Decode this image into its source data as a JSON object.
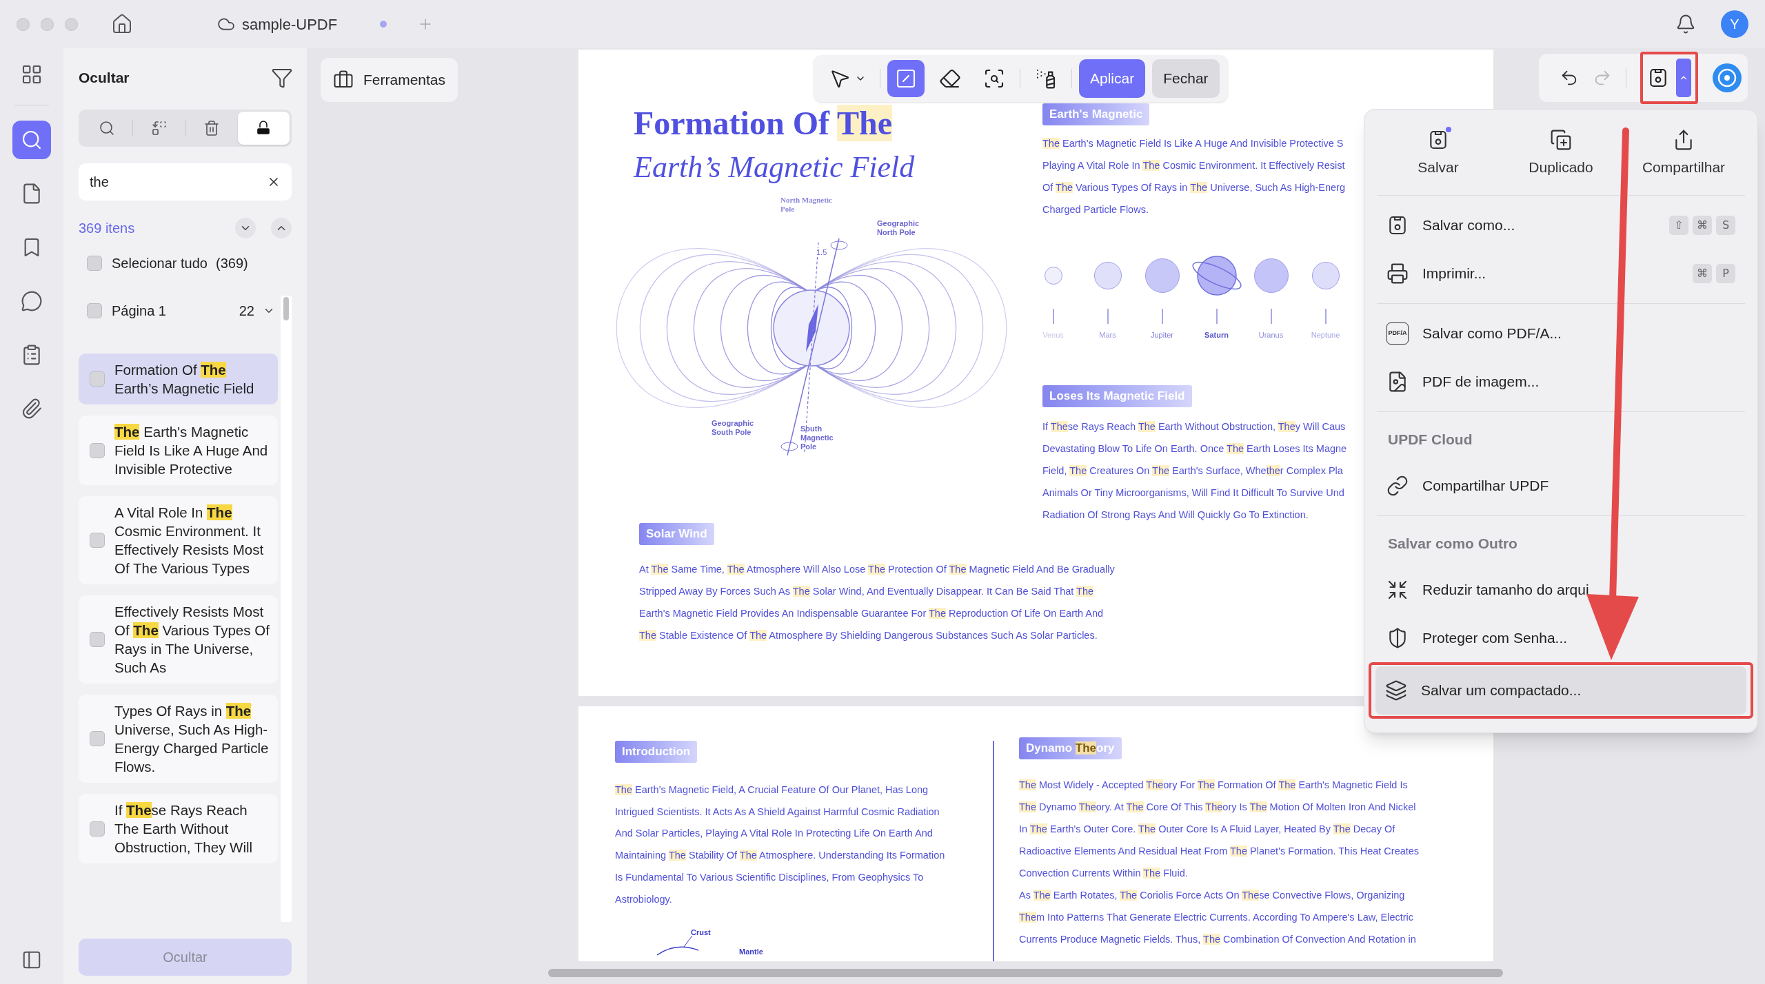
{
  "window": {
    "tab_title": "sample-UPDF",
    "unsaved": true,
    "avatar": "Y"
  },
  "rail": [
    {
      "kind": "apps",
      "selected": false
    },
    {
      "kind": "search",
      "selected": true
    },
    {
      "kind": "pages",
      "selected": false
    },
    {
      "kind": "bookmarks",
      "selected": false
    },
    {
      "kind": "comments",
      "selected": false
    },
    {
      "kind": "forms",
      "selected": false
    },
    {
      "kind": "attachments",
      "selected": false
    }
  ],
  "sidebar": {
    "title": "Ocultar",
    "modes": [
      {
        "kind": "search",
        "selected": false
      },
      {
        "kind": "replace",
        "selected": false
      },
      {
        "kind": "delete",
        "selected": false
      },
      {
        "kind": "redact",
        "selected": true
      }
    ],
    "search": {
      "value": "the"
    },
    "count": "369 itens",
    "select_all": {
      "label": "Selecionar tudo",
      "count": "(369)",
      "checked": false
    },
    "page_group": {
      "label": "Página 1",
      "count": "22",
      "checked": false
    },
    "results": [
      {
        "selected": true,
        "checked": false,
        "parts": [
          "Formation Of ",
          {
            "text": "The",
            "highlighted": true
          },
          " Earth’s Magnetic Field"
        ]
      },
      {
        "selected": false,
        "checked": false,
        "parts": [
          {
            "text": "The",
            "highlighted": true
          },
          " Earth's Magnetic Field Is Like A Huge And Invisible Protective"
        ]
      },
      {
        "selected": false,
        "checked": false,
        "parts": [
          "A Vital Role In ",
          {
            "text": "The",
            "highlighted": true
          },
          " Cosmic Environment. It Effectively Resists Most Of The Various Types"
        ]
      },
      {
        "selected": false,
        "checked": false,
        "parts": [
          "Effectively Resists Most Of ",
          {
            "text": "The",
            "highlighted": true
          },
          " Various Types Of Rays in The Universe, Such As"
        ]
      },
      {
        "selected": false,
        "checked": false,
        "parts": [
          "Types Of Rays in ",
          {
            "text": "The",
            "highlighted": true
          },
          " Universe, Such As High-Energy Charged Particle Flows."
        ]
      },
      {
        "selected": false,
        "checked": false,
        "parts": [
          "If ",
          {
            "text": "The",
            "highlighted": true
          },
          "se Rays Reach The Earth Without Obstruction, They Will"
        ]
      }
    ],
    "button": {
      "label": "Ocultar",
      "disabled": true
    }
  },
  "tools_button": "Ferramentas",
  "redact_toolbar": {
    "tools": [
      {
        "kind": "select",
        "selected": false
      },
      {
        "kind": "text",
        "selected": true
      },
      {
        "kind": "area",
        "selected": false
      },
      {
        "kind": "search",
        "selected": false
      },
      {
        "kind": "sanitize",
        "selected": false
      }
    ],
    "apply": "Aplicar",
    "close": "Fechar"
  },
  "file_toolbar": {
    "redo_disabled": true
  },
  "page1": {
    "title": [
      "Formation Of ",
      {
        "text": "The",
        "highlighted": true
      }
    ],
    "subtitle": "Earth’s Magnetic Field",
    "diagram_labels": [
      "North Magnetic Pole",
      "Geographic North Pole",
      "1.5",
      "Geographic South Pole",
      "South Magnetic Pole"
    ],
    "magnetic": {
      "heading": [
        "Earth's Magnetic"
      ],
      "lines": [
        [
          {
            "text": "The",
            "highlighted": true
          },
          " Earth's Magnetic Field Is Like A Huge And Invisible Protective S"
        ],
        [
          "Playing A Vital Role In ",
          {
            "text": "The",
            "highlighted": true
          },
          " Cosmic Environment. It Effectively Resist"
        ],
        [
          "Of ",
          {
            "text": "The",
            "highlighted": true
          },
          " Various Types Of Rays in ",
          {
            "text": "The",
            "highlighted": true
          },
          " Universe, Such As High-Energ"
        ],
        [
          "Charged Particle Flows."
        ]
      ]
    },
    "planets": [
      {
        "name": "Venus",
        "kind": "plain"
      },
      {
        "name": "Mars",
        "kind": "plain"
      },
      {
        "name": "Jupiter",
        "kind": "plain"
      },
      {
        "name": "Saturn",
        "kind": "ringed"
      },
      {
        "name": "Uranus",
        "kind": "plain"
      },
      {
        "name": "Neptune",
        "kind": "plain"
      }
    ],
    "loses": {
      "heading": [
        "Loses Its Magnetic Field"
      ],
      "lines": [
        [
          "If ",
          {
            "text": "The",
            "highlighted": true
          },
          "se Rays Reach ",
          {
            "text": "The",
            "highlighted": true
          },
          " Earth Without Obstruction, ",
          {
            "text": "The",
            "highlighted": true
          },
          "y Will Caus"
        ],
        [
          "Devastating Blow To Life On Earth. Once ",
          {
            "text": "The",
            "highlighted": true
          },
          " Earth Loses Its Magne"
        ],
        [
          "Field, ",
          {
            "text": "The",
            "highlighted": true
          },
          " Creatures On ",
          {
            "text": "The",
            "highlighted": true
          },
          " Earth's Surface, Whe",
          {
            "text": "the",
            "highlighted": true
          },
          "r Complex Pla"
        ],
        [
          "Animals Or Tiny Microorganisms, Will Find It Difficult To Survive Und"
        ],
        [
          "Radiation Of Strong Rays And Will Quickly Go To Extinction."
        ]
      ]
    },
    "solar": {
      "heading": [
        "Solar Wind"
      ],
      "lines": [
        [
          "At ",
          {
            "text": "The",
            "highlighted": true
          },
          " Same Time, ",
          {
            "text": "The",
            "highlighted": true
          },
          " Atmosphere Will Also Lose ",
          {
            "text": "The",
            "highlighted": true
          },
          " Protection Of ",
          {
            "text": "The",
            "highlighted": true
          },
          " Magnetic Field And Be Gradually"
        ],
        [
          "Stripped Away By Forces Such As ",
          {
            "text": "The",
            "highlighted": true
          },
          " Solar Wind, And Eventually Disappear. It Can Be Said That ",
          {
            "text": "The",
            "highlighted": true
          }
        ],
        [
          "Earth's Magnetic Field Provides An Indispensable Guarantee For ",
          {
            "text": "The",
            "highlighted": true
          },
          " Reproduction Of Life On Earth And"
        ],
        [
          {
            "text": "The",
            "highlighted": true
          },
          " Stable Existence Of ",
          {
            "text": "The",
            "highlighted": true
          },
          " Atmosphere By Shielding Dangerous Substances Such As Solar Particles."
        ]
      ]
    }
  },
  "page2": {
    "intro": {
      "heading": [
        "Introduction"
      ],
      "lines": [
        [
          {
            "text": "The",
            "highlighted": true
          },
          " Earth's Magnetic Field, A Crucial Feature Of Our Planet, Has Long"
        ],
        [
          "Intrigued Scientists. It Acts As A Shield Against Harmful Cosmic Radiation"
        ],
        [
          "And Solar Particles, Playing A Vital Role In Protecting Life On Earth And"
        ],
        [
          "Maintaining ",
          {
            "text": "The",
            "highlighted": true
          },
          " Stability Of ",
          {
            "text": "The",
            "highlighted": true
          },
          " Atmosphere. Understanding Its Formation"
        ],
        [
          "Is Fundamental To Various Scientific Disciplines, From Geophysics To"
        ],
        [
          "Astrobiology."
        ]
      ]
    },
    "figure_labels": [
      "Crust",
      "Mantle"
    ],
    "dynamo": {
      "heading": [
        "Dynamo ",
        {
          "text": "The",
          "highlighted": true
        },
        "ory"
      ],
      "lines": [
        [
          {
            "text": "The",
            "highlighted": true
          },
          " Most Widely - Accepted ",
          {
            "text": "The",
            "highlighted": true
          },
          "ory For ",
          {
            "text": "The",
            "highlighted": true
          },
          " Formation Of ",
          {
            "text": "The",
            "highlighted": true
          },
          " Earth's Magnetic Field Is"
        ],
        [
          {
            "text": "The",
            "highlighted": true
          },
          " Dynamo ",
          {
            "text": "The",
            "highlighted": true
          },
          "ory. At ",
          {
            "text": "The",
            "highlighted": true
          },
          " Core Of This ",
          {
            "text": "The",
            "highlighted": true
          },
          "ory Is ",
          {
            "text": "The",
            "highlighted": true
          },
          " Motion Of Molten Iron And Nickel"
        ],
        [
          "In ",
          {
            "text": "The",
            "highlighted": true
          },
          " Earth's Outer Core. ",
          {
            "text": "The",
            "highlighted": true
          },
          " Outer Core Is A Fluid Layer, Heated By ",
          {
            "text": "The",
            "highlighted": true
          },
          " Decay Of"
        ],
        [
          "Radioactive Elements And Residual Heat From ",
          {
            "text": "The",
            "highlighted": true
          },
          " Planet's Formation. This Heat Creates"
        ],
        [
          "Convection Currents Within ",
          {
            "text": "The",
            "highlighted": true
          },
          " Fluid."
        ],
        [
          "As ",
          {
            "text": "The",
            "highlighted": true
          },
          " Earth Rotates, ",
          {
            "text": "The",
            "highlighted": true
          },
          " Coriolis Force Acts On ",
          {
            "text": "The",
            "highlighted": true
          },
          "se Convective Flows, Organizing"
        ],
        [
          {
            "text": "The",
            "highlighted": true
          },
          "m Into Patterns That Generate Electric Currents. According To Ampere's Law, Electric"
        ],
        [
          "Currents Produce Magnetic Fields. Thus, ",
          {
            "text": "The",
            "highlighted": true
          },
          " Combination Of Convection And Rotation in"
        ]
      ]
    }
  },
  "save_menu": {
    "actions": [
      {
        "kind": "save",
        "label": "Salvar",
        "badge": true
      },
      {
        "kind": "duplicate",
        "label": "Duplicado",
        "badge": false
      },
      {
        "kind": "share",
        "label": "Compartilhar",
        "badge": false
      }
    ],
    "groups": [
      {
        "items": [
          {
            "kind": "save-as",
            "label": "Salvar como...",
            "shortcut": [
              "⇧",
              "⌘",
              "S"
            ],
            "selected": false
          },
          {
            "kind": "print",
            "label": "Imprimir...",
            "shortcut": [
              "⌘",
              "P"
            ],
            "selected": false
          }
        ]
      },
      {
        "items": [
          {
            "kind": "pdfa",
            "label": "Salvar como PDF/A...",
            "icon_text": "PDF/A",
            "selected": false
          },
          {
            "kind": "image-pdf",
            "label": "PDF de imagem...",
            "selected": false
          }
        ]
      },
      {
        "header": "UPDF Cloud",
        "items": [
          {
            "kind": "link",
            "label": "Compartilhar UPDF",
            "selected": false
          }
        ]
      },
      {
        "header": "Salvar como Outro",
        "items": [
          {
            "kind": "compress",
            "label": "Reduzir tamanho do arqui",
            "selected": false
          },
          {
            "kind": "protect",
            "label": "Proteger com Senha...",
            "selected": false
          },
          {
            "kind": "flatten",
            "label": "Salvar um compactado...",
            "selected": true
          }
        ]
      }
    ]
  }
}
